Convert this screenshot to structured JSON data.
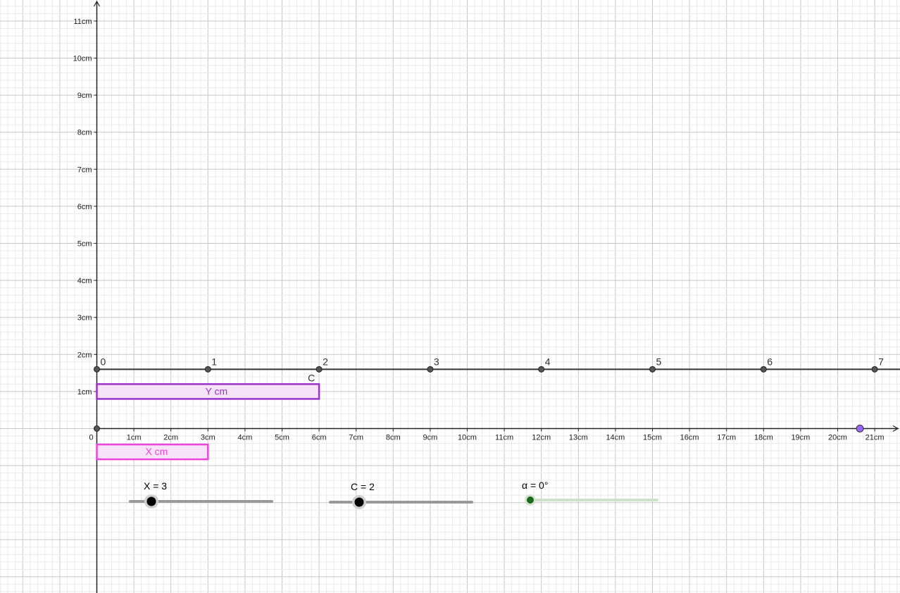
{
  "axes": {
    "x_ticks": [
      "0",
      "1cm",
      "2cm",
      "3cm",
      "4cm",
      "5cm",
      "6cm",
      "7cm",
      "8cm",
      "9cm",
      "10cm",
      "11cm",
      "12cm",
      "13cm",
      "14cm",
      "15cm",
      "16cm",
      "17cm",
      "18cm",
      "19cm",
      "20cm",
      "21cm"
    ],
    "y_ticks": [
      "1cm",
      "2cm",
      "3cm",
      "4cm",
      "5cm",
      "6cm",
      "7cm",
      "8cm",
      "9cm",
      "10cm",
      "11cm"
    ]
  },
  "number_line": {
    "labels": [
      "0",
      "1",
      "2",
      "3",
      "4",
      "5",
      "6",
      "7"
    ],
    "step_cm": 3,
    "y_cm": 1.6
  },
  "point_c": {
    "label": "C",
    "x_cm": 6
  },
  "box_y": {
    "label": "Y cm",
    "width_cm": 6
  },
  "box_x": {
    "label": "X cm",
    "width_cm": 3
  },
  "point_on_axis": {
    "x_cm": 20.6
  },
  "sliders": {
    "x": {
      "label": "X = 3",
      "value": 3
    },
    "c": {
      "label": "C = 2",
      "value": 2
    },
    "alpha": {
      "label": "α = 0°",
      "value": 0
    }
  },
  "colors": {
    "grid_major": "#c8c8c8",
    "grid_minor": "#eaeaea",
    "axis": "#222222",
    "box_y_stroke": "#9933cc",
    "box_x_stroke": "#ee44dd",
    "box_fill": "#f6e3f7",
    "point_purple": "#9966ff",
    "slider_track": "#999999",
    "alpha_track": "#cfe0cc",
    "alpha_color": "#1a6b1a"
  }
}
